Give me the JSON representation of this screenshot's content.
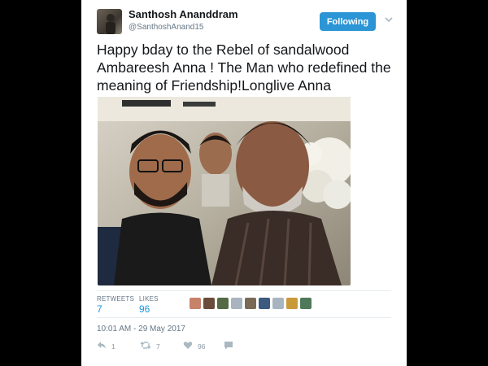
{
  "tweet": {
    "author_name": "Santhosh Ananddram",
    "author_handle": "@SanthoshAnand15",
    "follow_label": "Following",
    "text": "Happy bday to the Rebel of sandalwood Ambareesh Anna ! The Man who redefined the meaning of Friendship!Longlive Anna",
    "stats": {
      "retweets_label": "RETWEETS",
      "retweets": "7",
      "likes_label": "LIKES",
      "likes": "96"
    },
    "timestamp": "10:01 AM - 29 May 2017",
    "actions": {
      "reply_count": "1",
      "retweet_count": "7",
      "like_count": "96"
    }
  },
  "colors": {
    "accent": "#1b95e0",
    "follow_button": "#2b95d6",
    "muted": "#657786"
  },
  "icons": [
    "chevron-down-icon",
    "reply-icon",
    "retweet-icon",
    "heart-icon",
    "direct-message-icon"
  ]
}
